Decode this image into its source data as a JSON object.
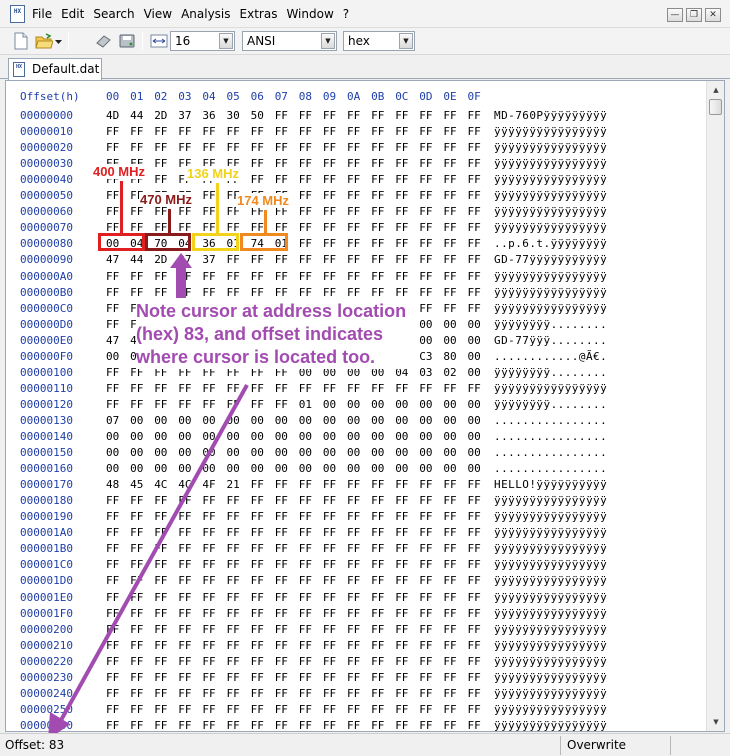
{
  "menubar": {
    "app_icon_text": "HX",
    "items": [
      "File",
      "Edit",
      "Search",
      "View",
      "Analysis",
      "Extras",
      "Window",
      "?"
    ],
    "window_buttons": [
      "minimize",
      "restore",
      "close"
    ]
  },
  "toolbar": {
    "icons": [
      "new-file-icon",
      "open-folder-icon",
      "dropdown-arrow-icon",
      "eraser-icon",
      "save-disk-icon",
      "bytes-per-row-icon"
    ],
    "bytes_per_row": "16",
    "charset": "ANSI",
    "offset_base": "hex"
  },
  "tab": {
    "label": "Default.dat"
  },
  "hexview": {
    "header": {
      "offset_label": "Offset(h)",
      "columns": [
        "00",
        "01",
        "02",
        "03",
        "04",
        "05",
        "06",
        "07",
        "08",
        "09",
        "0A",
        "0B",
        "0C",
        "0D",
        "0E",
        "0F"
      ]
    },
    "rows": [
      {
        "offset": "00000000",
        "bytes": "4D 44 2D 37 36 30 50 FF FF FF FF FF FF FF FF FF",
        "ascii": "MD-760Pÿÿÿÿÿÿÿÿÿ"
      },
      {
        "offset": "00000010",
        "bytes": "FF FF FF FF FF FF FF FF FF FF FF FF FF FF FF FF",
        "ascii": "ÿÿÿÿÿÿÿÿÿÿÿÿÿÿÿÿ"
      },
      {
        "offset": "00000020",
        "bytes": "FF FF FF FF FF FF FF FF FF FF FF FF FF FF FF FF",
        "ascii": "ÿÿÿÿÿÿÿÿÿÿÿÿÿÿÿÿ"
      },
      {
        "offset": "00000030",
        "bytes": "FF FF FF FF FF FF FF FF FF FF FF FF FF FF FF FF",
        "ascii": "ÿÿÿÿÿÿÿÿÿÿÿÿÿÿÿÿ"
      },
      {
        "offset": "00000040",
        "bytes": "FF FF FF FF FF FF FF FF FF FF FF FF FF FF FF FF",
        "ascii": "ÿÿÿÿÿÿÿÿÿÿÿÿÿÿÿÿ"
      },
      {
        "offset": "00000050",
        "bytes": "FF FF FF FF FF FF FF FF FF FF FF FF FF FF FF FF",
        "ascii": "ÿÿÿÿÿÿÿÿÿÿÿÿÿÿÿÿ"
      },
      {
        "offset": "00000060",
        "bytes": "FF FF FF FF FF FF FF FF FF FF FF FF FF FF FF FF",
        "ascii": "ÿÿÿÿÿÿÿÿÿÿÿÿÿÿÿÿ"
      },
      {
        "offset": "00000070",
        "bytes": "FF FF FF FF FF FF FF FF FF FF FF FF FF FF FF FF",
        "ascii": "ÿÿÿÿÿÿÿÿÿÿÿÿÿÿÿÿ"
      },
      {
        "offset": "00000080",
        "bytes": "00 04 70 04 36 01 74 01 FF FF FF FF FF FF FF FF",
        "ascii": "..p.6.t.ÿÿÿÿÿÿÿÿ"
      },
      {
        "offset": "00000090",
        "bytes": "47 44 2D 37 37 FF FF FF FF FF FF FF FF FF FF FF",
        "ascii": "GD-77ÿÿÿÿÿÿÿÿÿÿÿ"
      },
      {
        "offset": "000000A0",
        "bytes": "FF FF FF FF FF FF FF FF FF FF FF FF FF FF FF FF",
        "ascii": "ÿÿÿÿÿÿÿÿÿÿÿÿÿÿÿÿ"
      },
      {
        "offset": "000000B0",
        "bytes": "FF FF FF FF FF FF FF FF FF FF FF FF FF FF FF FF",
        "ascii": "ÿÿÿÿÿÿÿÿÿÿÿÿÿÿÿÿ"
      },
      {
        "offset": "000000C0",
        "bytes": "FF FF FF FF FF FF FF FF FF FF FF FF FF FF FF FF",
        "ascii": "ÿÿÿÿÿÿÿÿÿÿÿÿÿÿÿÿ"
      },
      {
        "offset": "000000D0",
        "bytes": "FF FF FF FF FF FF FF FF 00 00 00 00 00 00 00 00",
        "ascii": "ÿÿÿÿÿÿÿÿ........"
      },
      {
        "offset": "000000E0",
        "bytes": "47 44 2D 37 37 FF FF FF 00 00 00 00 00 00 00 00",
        "ascii": "GD-77ÿÿÿ........"
      },
      {
        "offset": "000000F0",
        "bytes": "00 06 00 00 00 00 00 00 00 00 00 00 40 C3 80 00",
        "ascii": "............@Ã€."
      },
      {
        "offset": "00000100",
        "bytes": "FF FF FF FF FF FF FF FF 00 00 00 00 04 03 02 00",
        "ascii": "ÿÿÿÿÿÿÿÿ........"
      },
      {
        "offset": "00000110",
        "bytes": "FF FF FF FF FF FF FF FF FF FF FF FF FF FF FF FF",
        "ascii": "ÿÿÿÿÿÿÿÿÿÿÿÿÿÿÿÿ"
      },
      {
        "offset": "00000120",
        "bytes": "FF FF FF FF FF FF FF FF 01 00 00 00 00 00 00 00",
        "ascii": "ÿÿÿÿÿÿÿÿ........"
      },
      {
        "offset": "00000130",
        "bytes": "07 00 00 00 00 00 00 00 00 00 00 00 00 00 00 00",
        "ascii": "................"
      },
      {
        "offset": "00000140",
        "bytes": "00 00 00 00 00 00 00 00 00 00 00 00 00 00 00 00",
        "ascii": "................"
      },
      {
        "offset": "00000150",
        "bytes": "00 00 00 00 00 00 00 00 00 00 00 00 00 00 00 00",
        "ascii": "................"
      },
      {
        "offset": "00000160",
        "bytes": "00 00 00 00 00 00 00 00 00 00 00 00 00 00 00 00",
        "ascii": "................"
      },
      {
        "offset": "00000170",
        "bytes": "48 45 4C 4C 4F 21 FF FF FF FF FF FF FF FF FF FF",
        "ascii": "HELLO!ÿÿÿÿÿÿÿÿÿÿ"
      },
      {
        "offset": "00000180",
        "bytes": "FF FF FF FF FF FF FF FF FF FF FF FF FF FF FF FF",
        "ascii": "ÿÿÿÿÿÿÿÿÿÿÿÿÿÿÿÿ"
      },
      {
        "offset": "00000190",
        "bytes": "FF FF FF FF FF FF FF FF FF FF FF FF FF FF FF FF",
        "ascii": "ÿÿÿÿÿÿÿÿÿÿÿÿÿÿÿÿ"
      },
      {
        "offset": "000001A0",
        "bytes": "FF FF FF FF FF FF FF FF FF FF FF FF FF FF FF FF",
        "ascii": "ÿÿÿÿÿÿÿÿÿÿÿÿÿÿÿÿ"
      },
      {
        "offset": "000001B0",
        "bytes": "FF FF FF FF FF FF FF FF FF FF FF FF FF FF FF FF",
        "ascii": "ÿÿÿÿÿÿÿÿÿÿÿÿÿÿÿÿ"
      },
      {
        "offset": "000001C0",
        "bytes": "FF FF FF FF FF FF FF FF FF FF FF FF FF FF FF FF",
        "ascii": "ÿÿÿÿÿÿÿÿÿÿÿÿÿÿÿÿ"
      },
      {
        "offset": "000001D0",
        "bytes": "FF FF FF FF FF FF FF FF FF FF FF FF FF FF FF FF",
        "ascii": "ÿÿÿÿÿÿÿÿÿÿÿÿÿÿÿÿ"
      },
      {
        "offset": "000001E0",
        "bytes": "FF FF FF FF FF FF FF FF FF FF FF FF FF FF FF FF",
        "ascii": "ÿÿÿÿÿÿÿÿÿÿÿÿÿÿÿÿ"
      },
      {
        "offset": "000001F0",
        "bytes": "FF FF FF FF FF FF FF FF FF FF FF FF FF FF FF FF",
        "ascii": "ÿÿÿÿÿÿÿÿÿÿÿÿÿÿÿÿ"
      },
      {
        "offset": "00000200",
        "bytes": "FF FF FF FF FF FF FF FF FF FF FF FF FF FF FF FF",
        "ascii": "ÿÿÿÿÿÿÿÿÿÿÿÿÿÿÿÿ"
      },
      {
        "offset": "00000210",
        "bytes": "FF FF FF FF FF FF FF FF FF FF FF FF FF FF FF FF",
        "ascii": "ÿÿÿÿÿÿÿÿÿÿÿÿÿÿÿÿ"
      },
      {
        "offset": "00000220",
        "bytes": "FF FF FF FF FF FF FF FF FF FF FF FF FF FF FF FF",
        "ascii": "ÿÿÿÿÿÿÿÿÿÿÿÿÿÿÿÿ"
      },
      {
        "offset": "00000230",
        "bytes": "FF FF FF FF FF FF FF FF FF FF FF FF FF FF FF FF",
        "ascii": "ÿÿÿÿÿÿÿÿÿÿÿÿÿÿÿÿ"
      },
      {
        "offset": "00000240",
        "bytes": "FF FF FF FF FF FF FF FF FF FF FF FF FF FF FF FF",
        "ascii": "ÿÿÿÿÿÿÿÿÿÿÿÿÿÿÿÿ"
      },
      {
        "offset": "00000250",
        "bytes": "FF FF FF FF FF FF FF FF FF FF FF FF FF FF FF FF",
        "ascii": "ÿÿÿÿÿÿÿÿÿÿÿÿÿÿÿÿ"
      },
      {
        "offset": "00000260",
        "bytes": "FF FF FF FF FF FF FF FF FF FF FF FF FF FF FF FF",
        "ascii": "ÿÿÿÿÿÿÿÿÿÿÿÿÿÿÿÿ"
      }
    ],
    "cursor_offset": "83"
  },
  "annotations": {
    "labels": [
      {
        "text": "400 MHz",
        "color": "#e02020"
      },
      {
        "text": "470 MHz",
        "color": "#8b1a1a"
      },
      {
        "text": "136 MHz",
        "color": "#f2d21a"
      },
      {
        "text": "174 MHz",
        "color": "#f08a20"
      }
    ],
    "note": "Note cursor at address location (hex) 83, and offset indicates where cursor is located too.",
    "note_color": "#a24bb0"
  },
  "statusbar": {
    "offset_text": "Offset: 83",
    "mode_text": "Overwrite"
  }
}
